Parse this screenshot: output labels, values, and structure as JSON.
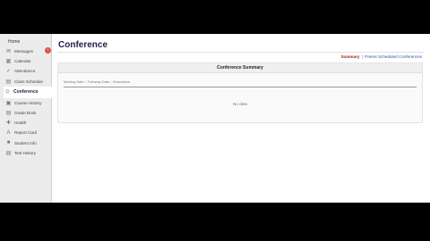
{
  "sidebar": {
    "home_label": "Home",
    "collapse_icon": "‹",
    "items": [
      {
        "label": "Messages",
        "icon": "✉"
      },
      {
        "label": "Calendar",
        "icon": "▦"
      },
      {
        "label": "Attendance",
        "icon": "✓"
      },
      {
        "label": "Class Schedule",
        "icon": "▤"
      },
      {
        "label": "Conference",
        "icon": "☺"
      },
      {
        "label": "Course History",
        "icon": "▣"
      },
      {
        "label": "Grade Book",
        "icon": "▤"
      },
      {
        "label": "Health",
        "icon": "✚"
      },
      {
        "label": "Report Card",
        "icon": "A"
      },
      {
        "label": "Student Info",
        "icon": "■"
      },
      {
        "label": "Test History",
        "icon": "▤"
      }
    ]
  },
  "main": {
    "title": "Conference",
    "links": {
      "summary": "Summary",
      "separator": "|",
      "parent_scheduled": "Parent Scheduled Conferences"
    },
    "panel": {
      "title": "Conference Summary",
      "columns": [
        "Meeting Date",
        "Followup Date",
        "Description"
      ],
      "empty_text": "No data"
    }
  }
}
